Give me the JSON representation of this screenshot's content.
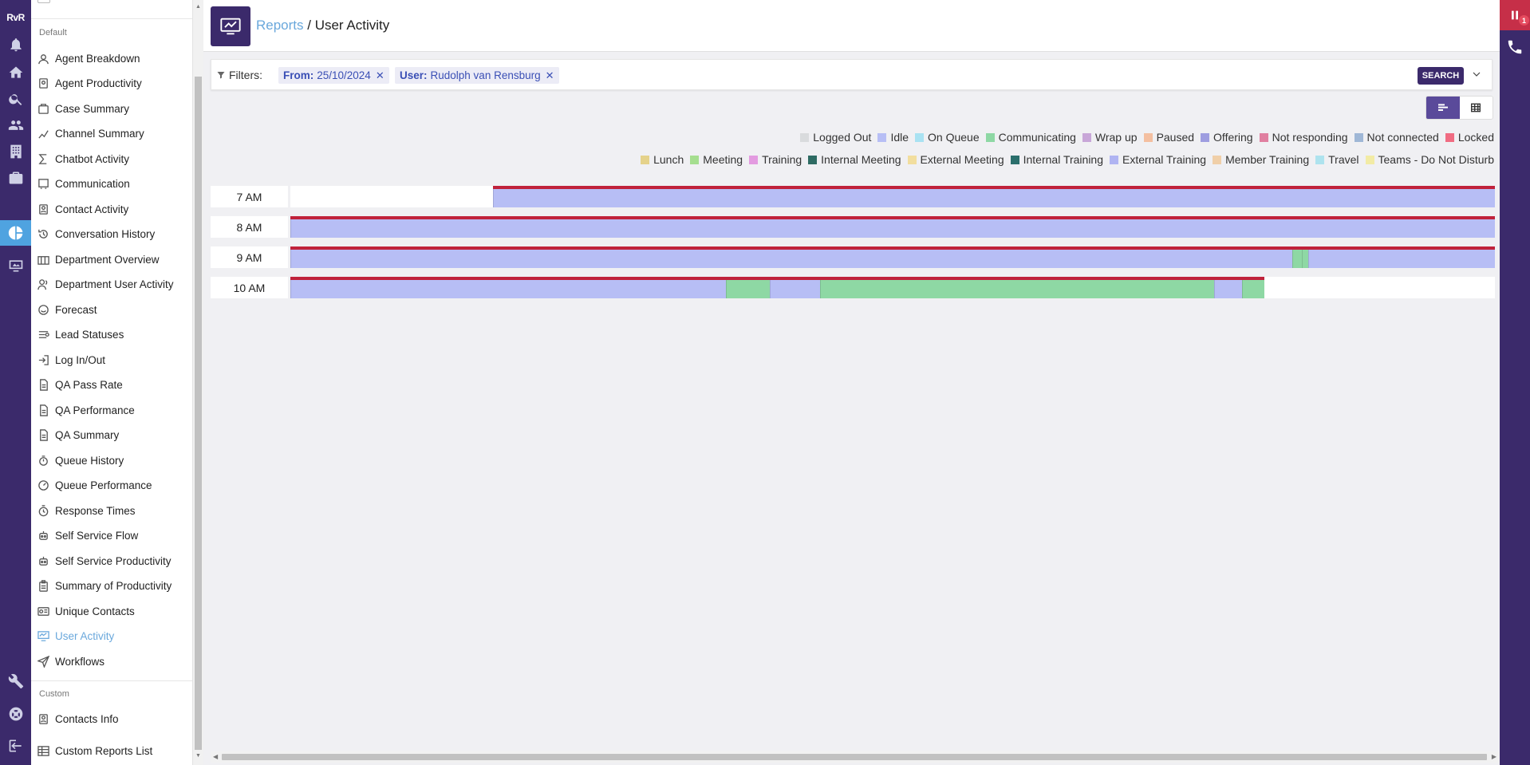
{
  "app": {
    "logo": "RvR"
  },
  "rail": {
    "icons": [
      "bell-icon",
      "home-icon",
      "search-icon",
      "people-icon",
      "building-icon",
      "briefcase-icon",
      "pie-chart-icon",
      "monitor-icon",
      "wrench-icon",
      "support-icon",
      "logout-icon"
    ],
    "active": "pie-chart-icon"
  },
  "menu": {
    "default_section": "Default",
    "items": [
      {
        "label": "Agent Breakdown",
        "icon": "agent-icon"
      },
      {
        "label": "Agent Productivity",
        "icon": "agent-productivity-icon"
      },
      {
        "label": "Case Summary",
        "icon": "case-icon"
      },
      {
        "label": "Channel Summary",
        "icon": "chart-line-icon"
      },
      {
        "label": "Chatbot Activity",
        "icon": "sigma-icon"
      },
      {
        "label": "Communication",
        "icon": "communication-icon"
      },
      {
        "label": "Contact Activity",
        "icon": "contact-icon"
      },
      {
        "label": "Conversation History",
        "icon": "history-icon"
      },
      {
        "label": "Department Overview",
        "icon": "department-icon"
      },
      {
        "label": "Department User Activity",
        "icon": "users-icon"
      },
      {
        "label": "Forecast",
        "icon": "forecast-icon"
      },
      {
        "label": "Lead Statuses",
        "icon": "lead-icon"
      },
      {
        "label": "Log In/Out",
        "icon": "login-icon"
      },
      {
        "label": "QA Pass Rate",
        "icon": "document-icon"
      },
      {
        "label": "QA Performance",
        "icon": "document-icon"
      },
      {
        "label": "QA Summary",
        "icon": "document-icon"
      },
      {
        "label": "Queue History",
        "icon": "queue-icon"
      },
      {
        "label": "Queue Performance",
        "icon": "gauge-icon"
      },
      {
        "label": "Response Times",
        "icon": "stopwatch-icon"
      },
      {
        "label": "Self Service Flow",
        "icon": "robot-icon"
      },
      {
        "label": "Self Service Productivity",
        "icon": "robot-icon"
      },
      {
        "label": "Summary of Productivity",
        "icon": "clipboard-icon"
      },
      {
        "label": "Unique Contacts",
        "icon": "id-card-icon"
      },
      {
        "label": "User Activity",
        "icon": "user-activity-icon",
        "active": true
      },
      {
        "label": "Workflows",
        "icon": "send-icon"
      }
    ],
    "custom_section": "Custom",
    "custom_items": [
      {
        "label": "Contacts Info",
        "icon": "contact-icon"
      },
      {
        "label": "Custom Reports List",
        "icon": "table-icon"
      }
    ]
  },
  "header": {
    "breadcrumb_link": "Reports",
    "separator": " / ",
    "title": "User Activity"
  },
  "filters": {
    "label": "Filters:",
    "chips": [
      {
        "key": "From:",
        "value": "25/10/2024"
      },
      {
        "key": "User:",
        "value": "Rudolph van Rensburg"
      }
    ],
    "search_label": "SEARCH"
  },
  "view_toggle": {
    "options": [
      "timeline-view-icon",
      "grid-view-icon"
    ],
    "selected": "timeline-view-icon"
  },
  "legend": {
    "row1": [
      {
        "label": "Logged Out",
        "color": "#d9dbdd"
      },
      {
        "label": "Idle",
        "color": "#b7bef5"
      },
      {
        "label": "On Queue",
        "color": "#a9e2f2"
      },
      {
        "label": "Communicating",
        "color": "#8ed8a4"
      },
      {
        "label": "Wrap up",
        "color": "#c8a6d8"
      },
      {
        "label": "Paused",
        "color": "#f4bfa0"
      },
      {
        "label": "Offering",
        "color": "#9e9de0"
      },
      {
        "label": "Not responding",
        "color": "#e07fa0"
      },
      {
        "label": "Not connected",
        "color": "#9fb7d6"
      },
      {
        "label": "Locked",
        "color": "#f06c82"
      }
    ],
    "row2": [
      {
        "label": "Lunch",
        "color": "#e5d28a"
      },
      {
        "label": "Meeting",
        "color": "#a5de8f"
      },
      {
        "label": "Training",
        "color": "#e39be0"
      },
      {
        "label": "Internal Meeting",
        "color": "#2e6b63"
      },
      {
        "label": "External Meeting",
        "color": "#f2de9e"
      },
      {
        "label": "Internal Training",
        "color": "#2b6f6c"
      },
      {
        "label": "External Training",
        "color": "#b0b4f2"
      },
      {
        "label": "Member Training",
        "color": "#f0cfa8"
      },
      {
        "label": "Travel",
        "color": "#aee3ee"
      },
      {
        "label": "Teams - Do Not Disturb",
        "color": "#f2eba5"
      }
    ]
  },
  "timeline": {
    "hours": [
      {
        "label": "7 AM",
        "segments": [
          {
            "state": "Idle",
            "start_min": 10.1,
            "end_min": 60
          }
        ],
        "redline": [
          10.1,
          60
        ]
      },
      {
        "label": "8 AM",
        "segments": [
          {
            "state": "Idle",
            "start_min": 0,
            "end_min": 60
          }
        ],
        "redline": [
          0,
          60
        ]
      },
      {
        "label": "9 AM",
        "segments": [
          {
            "state": "Idle",
            "start_min": 0,
            "end_min": 49.9
          },
          {
            "state": "Communicating",
            "start_min": 49.9,
            "end_min": 50.4
          },
          {
            "state": "Communicating",
            "start_min": 50.4,
            "end_min": 50.7
          },
          {
            "state": "Idle",
            "start_min": 50.7,
            "end_min": 60
          }
        ],
        "redline": [
          0,
          60
        ]
      },
      {
        "label": "10 AM",
        "segments": [
          {
            "state": "Idle",
            "start_min": 0,
            "end_min": 21.7
          },
          {
            "state": "Communicating",
            "start_min": 21.7,
            "end_min": 23.9
          },
          {
            "state": "Idle",
            "start_min": 23.9,
            "end_min": 26.4
          },
          {
            "state": "Communicating",
            "start_min": 26.4,
            "end_min": 46.0
          },
          {
            "state": "Idle",
            "start_min": 46.0,
            "end_min": 47.4
          },
          {
            "state": "Communicating",
            "start_min": 47.4,
            "end_min": 48.5
          }
        ],
        "redline": [
          0,
          48.5
        ]
      }
    ]
  },
  "right_bar": {
    "notification_count": "1"
  }
}
